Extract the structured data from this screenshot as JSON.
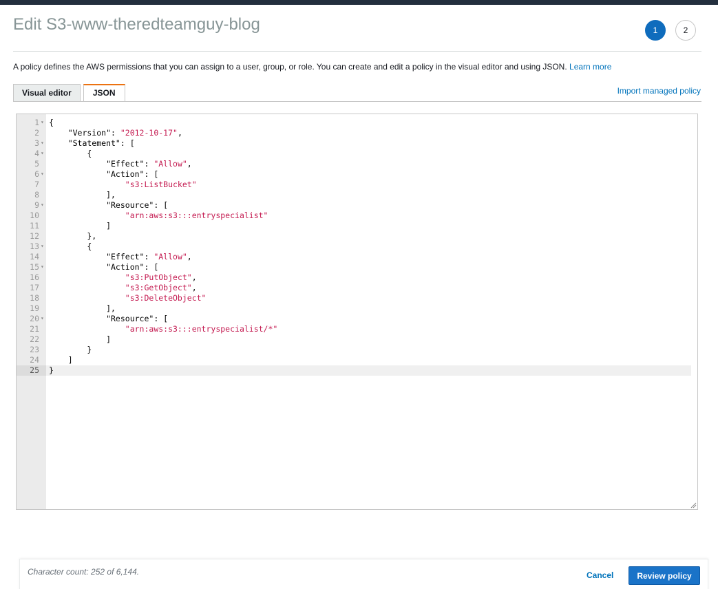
{
  "page": {
    "title": "Edit S3-www-theredteamguy-blog",
    "steps": [
      "1",
      "2"
    ],
    "active_step": "1"
  },
  "description": {
    "text": "A policy defines the AWS permissions that you can assign to a user, group, or role. You can create and edit a policy in the visual editor and using JSON. ",
    "link": "Learn more"
  },
  "tabs": [
    {
      "label": "Visual editor",
      "active": false
    },
    {
      "label": "JSON",
      "active": true
    }
  ],
  "import_link": "Import managed policy",
  "editor": {
    "current_line": 25,
    "fold_lines": [
      1,
      3,
      4,
      6,
      9,
      13,
      15,
      20
    ],
    "lines": [
      [
        [
          "k",
          "{"
        ]
      ],
      [
        [
          "k",
          "    \"Version\": "
        ],
        [
          "s",
          "\"2012-10-17\""
        ],
        [
          "k",
          ","
        ]
      ],
      [
        [
          "k",
          "    \"Statement\": ["
        ]
      ],
      [
        [
          "k",
          "        {"
        ]
      ],
      [
        [
          "k",
          "            \"Effect\": "
        ],
        [
          "s",
          "\"Allow\""
        ],
        [
          "k",
          ","
        ]
      ],
      [
        [
          "k",
          "            \"Action\": ["
        ]
      ],
      [
        [
          "s",
          "                \"s3:ListBucket\""
        ]
      ],
      [
        [
          "k",
          "            ],"
        ]
      ],
      [
        [
          "k",
          "            \"Resource\": ["
        ]
      ],
      [
        [
          "s",
          "                \"arn:aws:s3:::entryspecialist\""
        ]
      ],
      [
        [
          "k",
          "            ]"
        ]
      ],
      [
        [
          "k",
          "        },"
        ]
      ],
      [
        [
          "k",
          "        {"
        ]
      ],
      [
        [
          "k",
          "            \"Effect\": "
        ],
        [
          "s",
          "\"Allow\""
        ],
        [
          "k",
          ","
        ]
      ],
      [
        [
          "k",
          "            \"Action\": ["
        ]
      ],
      [
        [
          "s",
          "                \"s3:PutObject\""
        ],
        [
          "k",
          ","
        ]
      ],
      [
        [
          "s",
          "                \"s3:GetObject\""
        ],
        [
          "k",
          ","
        ]
      ],
      [
        [
          "s",
          "                \"s3:DeleteObject\""
        ]
      ],
      [
        [
          "k",
          "            ],"
        ]
      ],
      [
        [
          "k",
          "            \"Resource\": ["
        ]
      ],
      [
        [
          "s",
          "                \"arn:aws:s3:::entryspecialist/*\""
        ]
      ],
      [
        [
          "k",
          "            ]"
        ]
      ],
      [
        [
          "k",
          "        }"
        ]
      ],
      [
        [
          "k",
          "    ]"
        ]
      ],
      [
        [
          "k",
          "}"
        ]
      ]
    ]
  },
  "footer": {
    "char_count": "Character count: 252 of 6,144.",
    "cancel": "Cancel",
    "review": "Review policy"
  },
  "colors": {
    "accent": "#0073bb",
    "primary_button": "#1a73c8",
    "active_tab_border": "#ec7211",
    "json_string": "#c41a50"
  }
}
